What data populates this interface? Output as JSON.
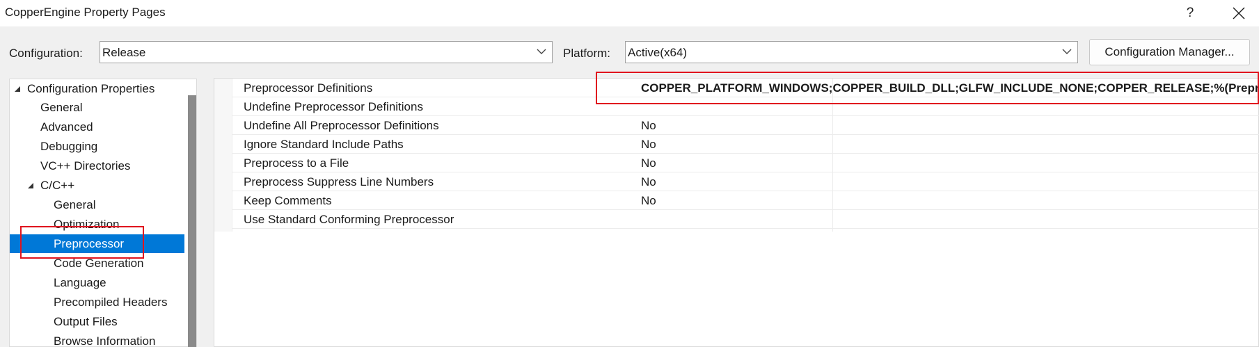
{
  "window": {
    "title": "CopperEngine Property Pages",
    "help_label": "?"
  },
  "toolbar": {
    "configuration_label": "Configuration:",
    "configuration_value": "Release",
    "platform_label": "Platform:",
    "platform_value": "Active(x64)",
    "config_manager_label": "Configuration Manager..."
  },
  "tree": {
    "root": "Configuration Properties",
    "items": [
      {
        "label": "General"
      },
      {
        "label": "Advanced"
      },
      {
        "label": "Debugging"
      },
      {
        "label": "VC++ Directories"
      },
      {
        "label": "C/C++"
      },
      {
        "label": "General"
      },
      {
        "label": "Optimization"
      },
      {
        "label": "Preprocessor",
        "selected": true
      },
      {
        "label": "Code Generation"
      },
      {
        "label": "Language"
      },
      {
        "label": "Precompiled Headers"
      },
      {
        "label": "Output Files"
      },
      {
        "label": "Browse Information"
      }
    ]
  },
  "properties": [
    {
      "name": "Preprocessor Definitions",
      "value": "COPPER_PLATFORM_WINDOWS;COPPER_BUILD_DLL;GLFW_INCLUDE_NONE;COPPER_RELEASE;%(Preproce",
      "bold": true
    },
    {
      "name": "Undefine Preprocessor Definitions",
      "value": ""
    },
    {
      "name": "Undefine All Preprocessor Definitions",
      "value": "No"
    },
    {
      "name": "Ignore Standard Include Paths",
      "value": "No"
    },
    {
      "name": "Preprocess to a File",
      "value": "No"
    },
    {
      "name": "Preprocess Suppress Line Numbers",
      "value": "No"
    },
    {
      "name": "Keep Comments",
      "value": "No"
    },
    {
      "name": "Use Standard Conforming Preprocessor",
      "value": ""
    }
  ],
  "colors": {
    "selection": "#0078d7",
    "annotation": "#e0141e"
  }
}
